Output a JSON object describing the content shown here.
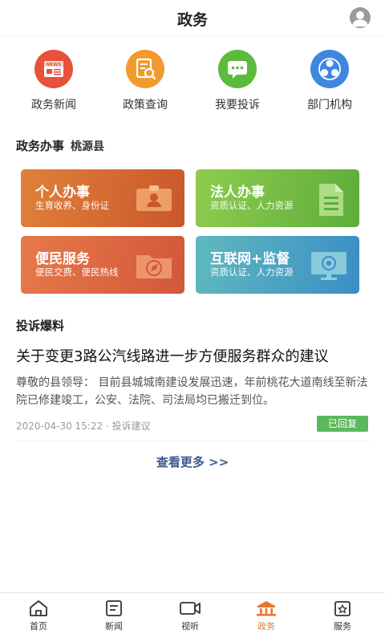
{
  "header": {
    "title": "政务"
  },
  "quick_links": [
    {
      "label": "政务新闻",
      "icon": "news-icon",
      "color": "#e8513a",
      "icon_text": "NEWS"
    },
    {
      "label": "政策查询",
      "icon": "policy-search-icon",
      "color": "#f29a2e"
    },
    {
      "label": "我要投诉",
      "icon": "complaint-chat-icon",
      "color": "#5cba3c"
    },
    {
      "label": "部门机构",
      "icon": "department-icon",
      "color": "#3f86e0"
    }
  ],
  "affairs": {
    "title": "政务办事",
    "county": "桃源县"
  },
  "cards": [
    {
      "title": "个人办事",
      "desc": "生育收养、身份证"
    },
    {
      "title": "法人办事",
      "desc": "资质认证、人力资源"
    },
    {
      "title": "便民服务",
      "desc": "便民交费、便民热线"
    },
    {
      "title": "互联网+监督",
      "desc": "资质认证、人力资源"
    }
  ],
  "complaints": {
    "title": "投诉爆料",
    "item": {
      "title": "关于变更3路公汽线路进一步方便服务群众的建议",
      "body": "尊敬的县领导：  目前县城城南建设发展迅速，年前桃花大道南线至新法院已修建竣工，公安、法院、司法局均已搬迁到位。",
      "meta": "2020-04-30 15:22 · 投诉建议",
      "status": "已回复"
    },
    "more": "查看更多 >>"
  },
  "tabbar": {
    "active_color": "#e6762e",
    "items": [
      {
        "label": "首页",
        "icon": "home-icon"
      },
      {
        "label": "新闻",
        "icon": "news-tab-icon"
      },
      {
        "label": "视听",
        "icon": "video-icon"
      },
      {
        "label": "政务",
        "icon": "government-icon",
        "active": true
      },
      {
        "label": "服务",
        "icon": "service-icon"
      }
    ]
  }
}
